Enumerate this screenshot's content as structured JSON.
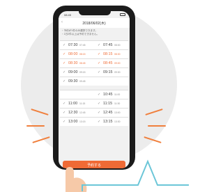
{
  "phone": {
    "status_time": "08:45",
    "app_title": "2018/06/02(木)",
    "notice_lines": [
      "・予約が1件のみ選択できます。",
      "・1日2件以上は予約できません。"
    ],
    "cta_label": "予約する"
  },
  "slots_top": [
    {
      "left": {
        "time": "07:30",
        "sub": "07:45",
        "selected": false
      },
      "right": {
        "time": "07:45",
        "sub": "08:00",
        "selected": false
      }
    },
    {
      "left": {
        "time": "08:00",
        "sub": "08:15",
        "selected": true
      },
      "right": {
        "time": "08:15",
        "sub": "08:30",
        "selected": true
      }
    },
    {
      "left": {
        "time": "08:30",
        "sub": "08:45",
        "selected": true
      },
      "right": {
        "time": "08:45",
        "sub": "09:00",
        "selected": true
      }
    },
    {
      "left": {
        "time": "09:00",
        "sub": "09:15",
        "selected": false
      },
      "right": {
        "time": "09:15",
        "sub": "09:30",
        "selected": false
      }
    },
    {
      "left": {
        "time": "09:30",
        "sub": "09:45",
        "selected": false
      },
      "right": {
        "time": "",
        "sub": "",
        "selected": false
      }
    }
  ],
  "slots_bottom": [
    {
      "left": {
        "time": "",
        "sub": "",
        "selected": false
      },
      "right": {
        "time": "10:45",
        "sub": "11:00",
        "selected": false
      }
    },
    {
      "left": {
        "time": "11:00",
        "sub": "11:15",
        "selected": false
      },
      "right": {
        "time": "11:15",
        "sub": "11:30",
        "selected": false
      }
    },
    {
      "left": {
        "time": "12:30",
        "sub": "12:45",
        "selected": false
      },
      "right": {
        "time": "12:45",
        "sub": "13:00",
        "selected": false
      }
    },
    {
      "left": {
        "time": "13:00",
        "sub": "13:15",
        "selected": false
      },
      "right": {
        "time": "13:15",
        "sub": "13:30",
        "selected": false
      }
    }
  ],
  "icons": {
    "check": "check-icon",
    "back": "chevron-left-icon"
  },
  "colors": {
    "accent": "#ef6a35",
    "selected_text": "#ef6f3a",
    "background_circle": "#ececec",
    "phone_body": "#1b1b1b",
    "callout_stroke": "#6cc6d8"
  }
}
